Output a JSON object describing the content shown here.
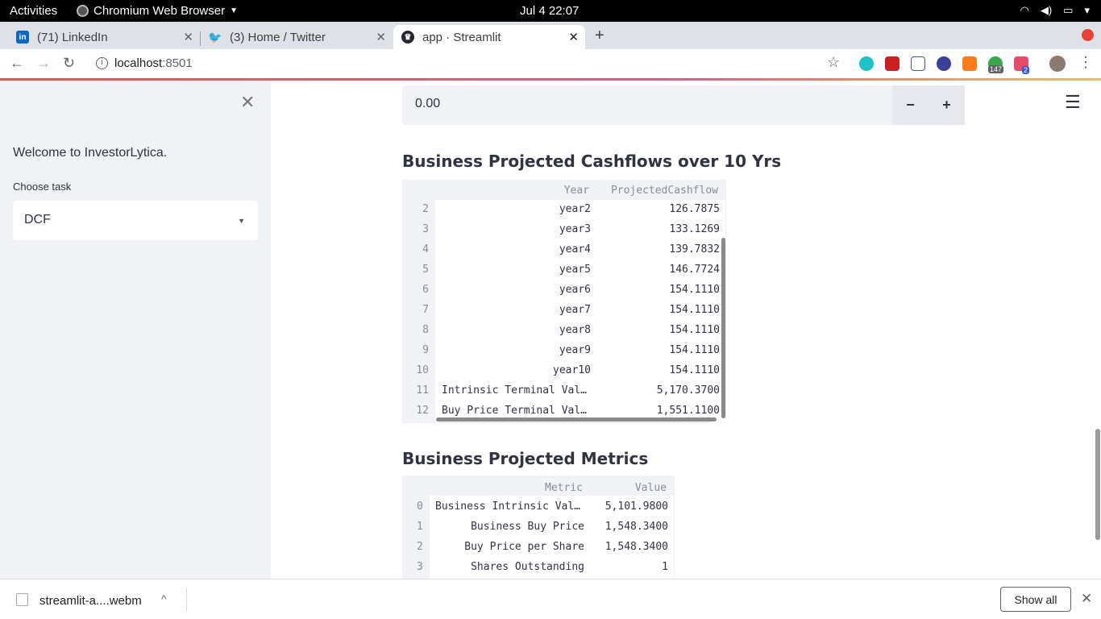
{
  "topbar": {
    "activities": "Activities",
    "app_name": "Chromium Web Browser",
    "clock": "Jul 4  22:07",
    "tray_icons": [
      "wifi-icon",
      "volume-icon",
      "battery-icon",
      "power-menu-icon"
    ]
  },
  "tabs": [
    {
      "title": "(71) LinkedIn",
      "icon": "linkedin-icon",
      "color": "#0a66c2",
      "active": false
    },
    {
      "title": "(3) Home / Twitter",
      "icon": "twitter-icon",
      "color": "#1da1f2",
      "active": false
    },
    {
      "title": "app · Streamlit",
      "icon": "streamlit-icon",
      "color": "#262730",
      "active": true
    }
  ],
  "toolbar": {
    "url_host": "localhost",
    "url_port": ":8501",
    "extension_badges": [
      "147",
      "2"
    ]
  },
  "sidebar": {
    "welcome": "Welcome to InvestorLytica.",
    "task_label": "Choose task",
    "task_value": "DCF"
  },
  "main": {
    "number_input_value": "0.00",
    "minus_label": "−",
    "plus_label": "+",
    "cashflow_heading": "Business Projected Cashflows over 10 Yrs",
    "cashflow_table": {
      "columns": [
        "Year",
        "ProjectedCashflow"
      ],
      "rows": [
        {
          "idx": "2",
          "year": "year2",
          "value": "126.7875"
        },
        {
          "idx": "3",
          "year": "year3",
          "value": "133.1269"
        },
        {
          "idx": "4",
          "year": "year4",
          "value": "139.7832"
        },
        {
          "idx": "5",
          "year": "year5",
          "value": "146.7724"
        },
        {
          "idx": "6",
          "year": "year6",
          "value": "154.1110"
        },
        {
          "idx": "7",
          "year": "year7",
          "value": "154.1110"
        },
        {
          "idx": "8",
          "year": "year8",
          "value": "154.1110"
        },
        {
          "idx": "9",
          "year": "year9",
          "value": "154.1110"
        },
        {
          "idx": "10",
          "year": "year10",
          "value": "154.1110"
        },
        {
          "idx": "11",
          "year": "Intrinsic Terminal Val…",
          "value": "5,170.3700"
        },
        {
          "idx": "12",
          "year": "Buy Price Terminal Val…",
          "value": "1,551.1100"
        }
      ]
    },
    "metrics_heading": "Business Projected Metrics",
    "metrics_table": {
      "columns": [
        "Metric",
        "Value"
      ],
      "rows": [
        {
          "idx": "0",
          "metric": "Business Intrinsic Val…",
          "value": "5,101.9800"
        },
        {
          "idx": "1",
          "metric": "Business Buy Price",
          "value": "1,548.3400"
        },
        {
          "idx": "2",
          "metric": "Buy Price per Share",
          "value": "1,548.3400"
        },
        {
          "idx": "3",
          "metric": "Shares Outstanding",
          "value": "1"
        }
      ]
    }
  },
  "downloads": {
    "filename": "streamlit-a....webm",
    "show_all": "Show all"
  }
}
